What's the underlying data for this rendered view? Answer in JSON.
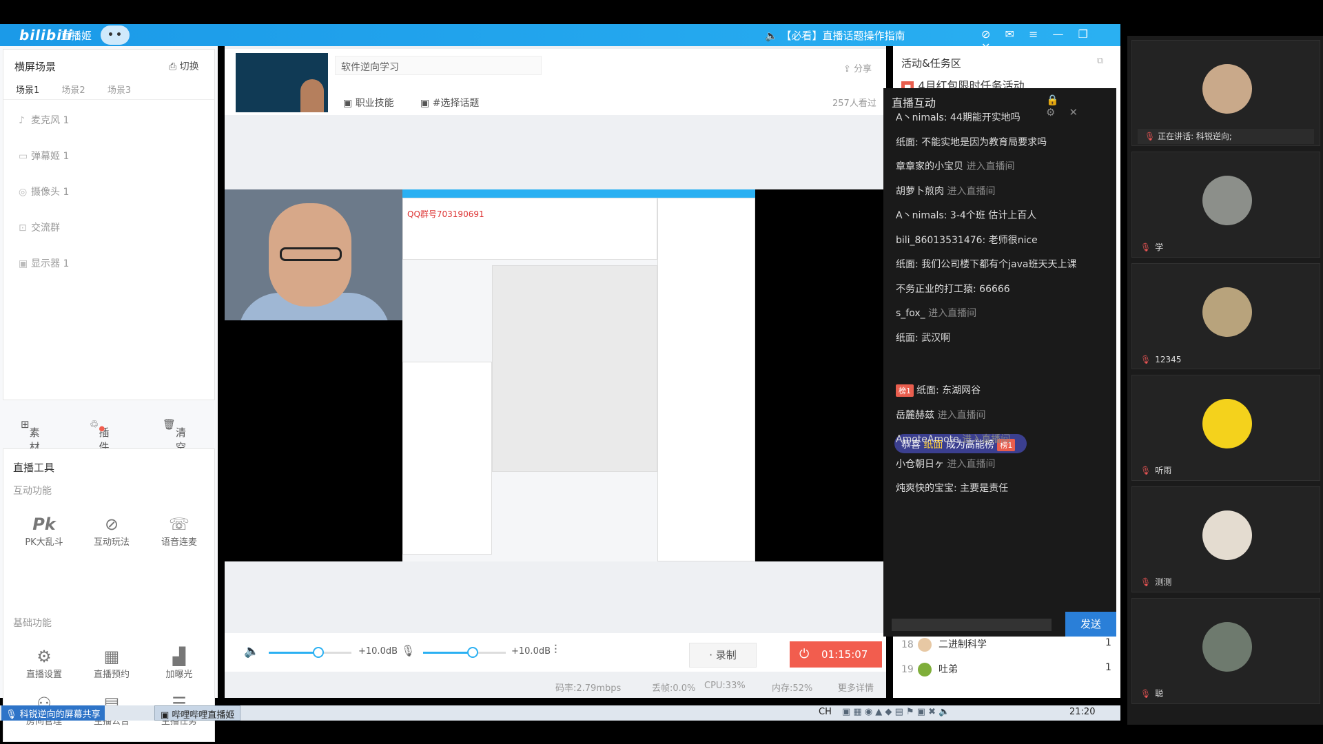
{
  "window": {
    "app_logo": "bilibili",
    "app_name": "直播姬",
    "notice": "【必看】直播话题操作指南",
    "controls": [
      "⊘",
      "✉",
      "≡",
      "—",
      "❐",
      "✕"
    ]
  },
  "scene": {
    "title": "横屏场景",
    "switch_label": "切换",
    "tabs": [
      "场景1",
      "场景2",
      "场景3"
    ],
    "sources": [
      {
        "icon": "mic-icon",
        "glyph": "♪",
        "label": "麦克风 1"
      },
      {
        "icon": "danmaku-icon",
        "glyph": "▭",
        "label": "弹幕姬 1"
      },
      {
        "icon": "camera-icon",
        "glyph": "◎",
        "label": "摄像头 1"
      },
      {
        "icon": "group-icon",
        "glyph": "⊡",
        "label": "交流群"
      },
      {
        "icon": "monitor-icon",
        "glyph": "▣",
        "label": "显示器 1"
      }
    ],
    "bottom": {
      "material": "素材",
      "plugin": "插件",
      "clear": "清空"
    }
  },
  "tools": {
    "title": "直播工具",
    "interactive_section": "互动功能",
    "interactive": [
      {
        "icon": "pk-icon",
        "glyph": "Pk",
        "label": "PK大乱斗"
      },
      {
        "icon": "interactive-play-icon",
        "glyph": "⊘",
        "label": "互动玩法"
      },
      {
        "icon": "voice-link-icon",
        "glyph": "☏",
        "label": "语音连麦"
      }
    ],
    "basic_section": "基础功能",
    "basic": [
      {
        "icon": "settings-icon",
        "glyph": "⚙",
        "label": "直播设置"
      },
      {
        "icon": "schedule-icon",
        "glyph": "▦",
        "label": "直播预约"
      },
      {
        "icon": "boost-icon",
        "glyph": "▟",
        "label": "加曝光"
      },
      {
        "icon": "room-manage-icon",
        "glyph": "⚇",
        "label": "房间管理"
      },
      {
        "icon": "announcement-icon",
        "glyph": "▤",
        "label": "主播公告"
      },
      {
        "icon": "task-icon",
        "glyph": "☰",
        "label": "主播任务"
      }
    ]
  },
  "stream": {
    "title": "软件逆向学习",
    "share": "分享",
    "tag_skill": "职业技能",
    "tag_topic": "#选择话题",
    "viewers": "257人看过",
    "inner_qq": "QQ群号703190691"
  },
  "audio": {
    "speaker_db": "+10.0dB",
    "mic_db": "+10.0dB",
    "speaker_level": 0.6,
    "mic_level": 0.6,
    "record": "录制",
    "live_time": "01:15:07"
  },
  "stats": {
    "bitrate": "码率:2.79mbps",
    "drop": "丢帧:0.0%",
    "cpu": "CPU:33%",
    "mem": "内存:52%",
    "more": "更多详情"
  },
  "activity": {
    "title": "活动&任务区",
    "banner": "4月红包限时任务活动",
    "rank_rows": [
      {
        "n": "18",
        "name": "二进制科学",
        "count": "1"
      },
      {
        "n": "19",
        "name": "吐弟",
        "count": "1"
      }
    ]
  },
  "chat": {
    "title": "直播互动",
    "send": "发送",
    "messages": [
      {
        "user": "A丶nimals",
        "text": "44期能开实地吗",
        "type": "msg"
      },
      {
        "user": "纸面",
        "text": "不能实地是因为教育局要求吗",
        "type": "msg"
      },
      {
        "user": "章章家的小宝贝",
        "text": "进入直播间",
        "type": "enter"
      },
      {
        "user": "胡萝卜煎肉",
        "text": "进入直播间",
        "type": "enter"
      },
      {
        "user": "A丶nimals",
        "text": "3-4个班 估计上百人",
        "type": "msg"
      },
      {
        "user": "bili_86013531476",
        "text": "老师很nice",
        "type": "msg"
      },
      {
        "user": "纸面",
        "text": "我们公司楼下都有个java班天天上课",
        "type": "msg"
      },
      {
        "user": "不务正业的打工猿",
        "text": "66666",
        "type": "msg"
      },
      {
        "user": "s_fox_",
        "text": "进入直播间",
        "type": "enter"
      },
      {
        "user": "纸面",
        "text": "武汉啊",
        "type": "msg"
      }
    ],
    "gift": {
      "pre": "恭喜",
      "user": "纸面",
      "post": "成为高能榜",
      "badge": "榜1"
    },
    "messages2": [
      {
        "badge": "榜1",
        "user": "纸面",
        "text": "东湖网谷",
        "type": "msg"
      },
      {
        "user": "岳麓赫兹",
        "text": "进入直播间",
        "type": "enter"
      },
      {
        "user": "AmoteAmote",
        "text": "进入直播间",
        "type": "enter"
      },
      {
        "user": "小仓朝日ヶ",
        "text": "进入直播间",
        "type": "enter"
      },
      {
        "user": "炖爽快的宝宝",
        "text": "主要是责任",
        "type": "msg"
      }
    ]
  },
  "participants": {
    "speaking": "正在讲话: 科锐逆向;",
    "tiles": [
      {
        "name": "",
        "color": "#c9a98a"
      },
      {
        "name": "学",
        "color": "#8c8f8a"
      },
      {
        "name": "12345",
        "color": "#b8a37c"
      },
      {
        "name": "听雨",
        "color": "#f4d21c"
      },
      {
        "name": "测测",
        "color": "#e4dcd0"
      },
      {
        "name": "聪",
        "color": "#6e7a6e"
      }
    ]
  },
  "taskbar": {
    "share_title": "科锐逆向的屏幕共享",
    "app": "哔哩哔哩直播姬",
    "lang": "CH",
    "clock": "21:20"
  },
  "colors": {
    "brand": "#2ab0f2",
    "live": "#f25d4e",
    "chat_bg": "#1a1a1a",
    "send": "#2a7fd8"
  }
}
